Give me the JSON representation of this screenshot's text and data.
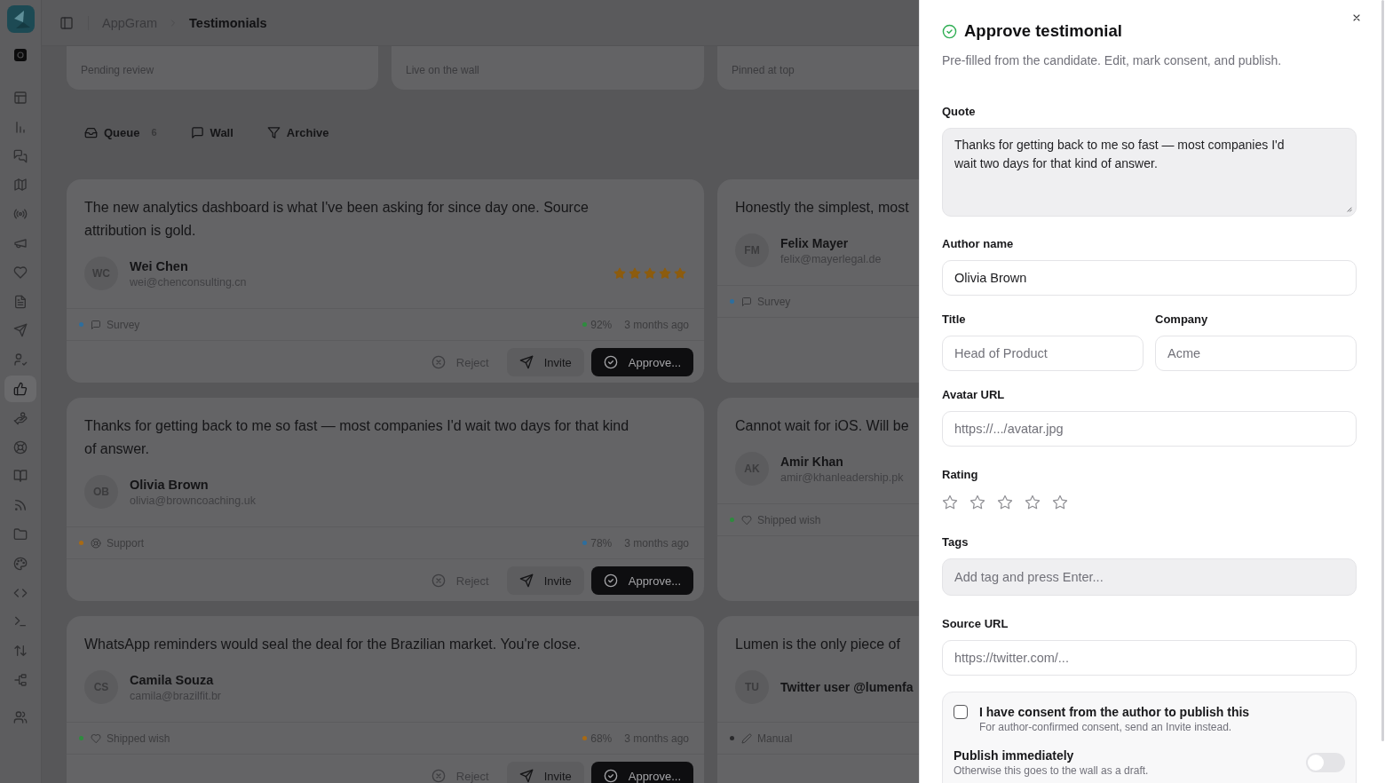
{
  "header": {
    "parent": "AppGram",
    "page": "Testimonials"
  },
  "sidebar": {
    "items": [
      {
        "selected": false
      },
      {
        "selected": false
      },
      {
        "selected": false
      },
      {
        "selected": false
      },
      {
        "selected": false
      },
      {
        "selected": false
      },
      {
        "selected": false
      },
      {
        "selected": false
      },
      {
        "selected": false
      },
      {
        "selected": false
      },
      {
        "selected": true
      },
      {
        "selected": false
      },
      {
        "selected": false
      },
      {
        "selected": false
      },
      {
        "selected": false
      },
      {
        "selected": false
      },
      {
        "selected": false
      },
      {
        "selected": false
      },
      {
        "selected": false
      },
      {
        "selected": false
      },
      {
        "selected": false
      },
      {
        "selected": false
      }
    ]
  },
  "stats": [
    {
      "label": "Pending review"
    },
    {
      "label": "Live on the wall"
    },
    {
      "label": "Pinned at top"
    }
  ],
  "tabs": [
    {
      "label": "Queue",
      "count": "6"
    },
    {
      "label": "Wall"
    },
    {
      "label": "Archive"
    }
  ],
  "testimonials": [
    {
      "quote": "The new analytics dashboard is what I've been asking for since day one. Source attribution is gold.",
      "initials": "WC",
      "name": "Wei Chen",
      "email": "wei@chenconsulting.cn",
      "stars": 5,
      "source": {
        "kind": "survey",
        "label": "Survey",
        "color": "#2d6e9e"
      },
      "score": {
        "value": "92%",
        "color": "#2e8b3e"
      },
      "age": "3 months ago",
      "actions": [
        {
          "kind": "reject",
          "label": "Reject"
        },
        {
          "kind": "invite",
          "label": "Invite"
        },
        {
          "kind": "approve",
          "label": "Approve..."
        }
      ]
    },
    {
      "quote": "Honestly the simplest, most",
      "initials": "FM",
      "name": "Felix Mayer",
      "email": "felix@mayerlegal.de",
      "source": {
        "kind": "survey",
        "label": "Survey",
        "color": "#2d6e9e"
      }
    },
    {
      "quote": "Thanks for getting back to me so fast — most companies I'd wait two days for that kind of answer.",
      "initials": "OB",
      "name": "Olivia Brown",
      "email": "olivia@browncoaching.uk",
      "source": {
        "kind": "support",
        "label": "Support",
        "color": "#a86a14"
      },
      "score": {
        "value": "78%",
        "color": "#2d6e9e"
      },
      "age": "3 months ago",
      "actions": [
        {
          "kind": "reject",
          "label": "Reject"
        },
        {
          "kind": "invite",
          "label": "Invite"
        },
        {
          "kind": "approve",
          "label": "Approve..."
        }
      ]
    },
    {
      "quote": "Cannot wait for iOS. Will be",
      "initials": "AK",
      "name": "Amir Khan",
      "email": "amir@khanleadership.pk",
      "source": {
        "kind": "shipped_wish",
        "label": "Shipped wish",
        "color": "#2e8b3e"
      }
    },
    {
      "quote": "WhatsApp reminders would seal the deal for the Brazilian market. You're close.",
      "initials": "CS",
      "name": "Camila Souza",
      "email": "camila@brazilfit.br",
      "source": {
        "kind": "shipped_wish",
        "label": "Shipped wish",
        "color": "#2e8b3e"
      },
      "score": {
        "value": "68%",
        "color": "#a86a14"
      },
      "age": "3 months ago",
      "actions": [
        {
          "kind": "reject",
          "label": "Reject"
        },
        {
          "kind": "invite",
          "label": "Invite"
        },
        {
          "kind": "approve",
          "label": "Approve..."
        }
      ]
    },
    {
      "quote": "Lumen is the only piece of",
      "initials": "TU",
      "name": "Twitter user @lumenfa",
      "source": {
        "kind": "manual",
        "label": "Manual",
        "color": "#2a2a2c"
      }
    }
  ],
  "dialog": {
    "title": "Approve testimonial",
    "subtitle": "Pre-filled from the candidate. Edit, mark consent, and publish.",
    "quote": {
      "label": "Quote",
      "value": "Thanks for getting back to me so fast — most companies I'd wait two days for that kind of answer."
    },
    "author_name": {
      "label": "Author name",
      "value": "Olivia Brown"
    },
    "title_field": {
      "label": "Title",
      "placeholder": "Head of Product"
    },
    "company": {
      "label": "Company",
      "placeholder": "Acme"
    },
    "avatar_url": {
      "label": "Avatar URL",
      "placeholder": "https://.../avatar.jpg"
    },
    "rating": {
      "label": "Rating",
      "stars": 0
    },
    "tags": {
      "label": "Tags",
      "placeholder": "Add tag and press Enter..."
    },
    "source_url": {
      "label": "Source URL",
      "placeholder": "https://twitter.com/..."
    },
    "consent": {
      "label": "I have consent from the author to publish this",
      "hint": "For author-confirmed consent, send an Invite instead.",
      "checked": false
    },
    "publish": {
      "label": "Publish immediately",
      "hint": "Otherwise this goes to the wall as a draft.",
      "on": false
    }
  }
}
